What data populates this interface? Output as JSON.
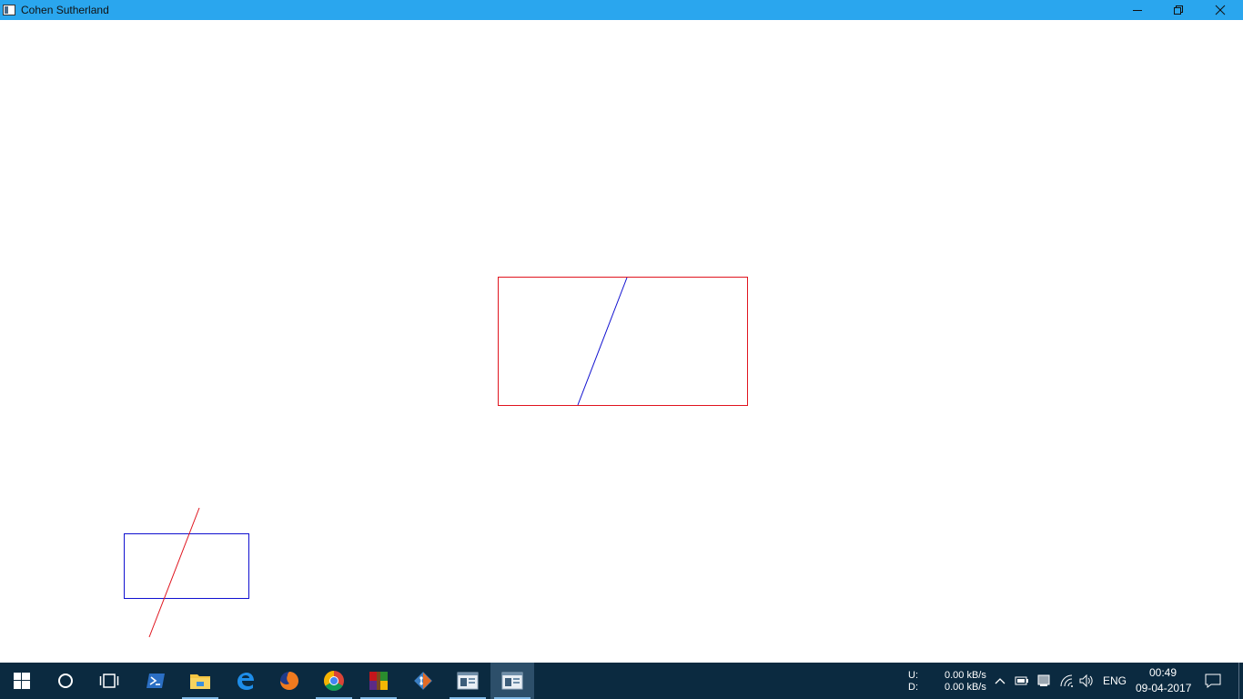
{
  "window": {
    "title": "Cohen Sutherland",
    "controls": [
      "minimize",
      "restore",
      "close"
    ]
  },
  "canvas": {
    "clip_window_main": {
      "border_color": "#e0141e"
    },
    "clipped_line": {
      "color": "#1010d0"
    },
    "clip_window_small": {
      "border_color": "#1010d0"
    },
    "original_line": {
      "color": "#e0141e"
    }
  },
  "taskbar": {
    "pinned": [
      "start-icon",
      "cortana-icon",
      "task-view-icon",
      "powershell-icon",
      "file-explorer-icon",
      "edge-icon",
      "firefox-icon",
      "chrome-icon",
      "winrar-icon",
      "git-icon",
      "app-window-icon",
      "cohen-sutherland-window-icon"
    ],
    "network_speed": {
      "upload_label": "U:",
      "upload_value": "0.00 kB/s",
      "download_label": "D:",
      "download_value": "0.00 kB/s"
    },
    "language": "ENG",
    "time": "00:49",
    "date": "09-04-2017"
  }
}
